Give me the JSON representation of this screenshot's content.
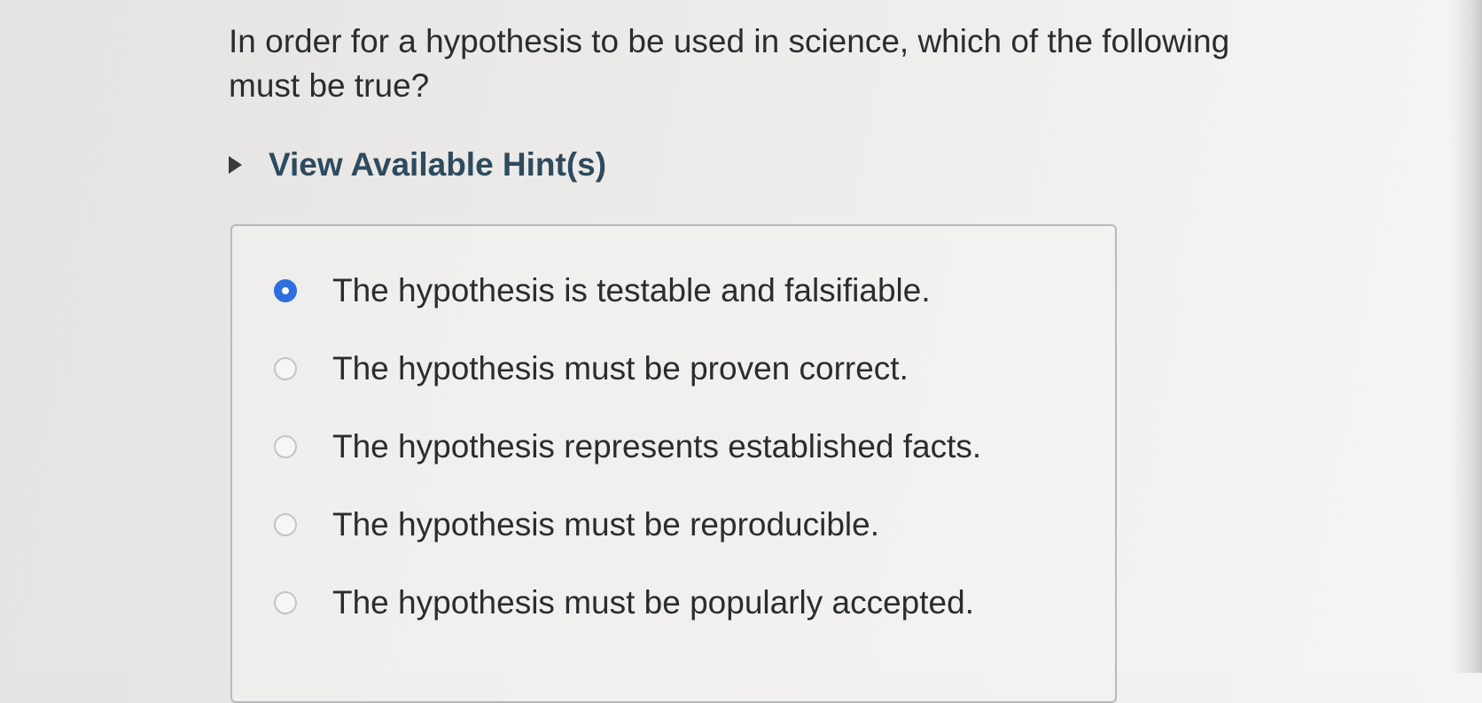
{
  "question": {
    "text": "In order for a hypothesis to be used in science, which of the following must be true?"
  },
  "hint": {
    "label": "View Available Hint(s)",
    "icon": "triangle-right-icon"
  },
  "options": [
    {
      "label": "The hypothesis is testable and falsifiable.",
      "selected": true
    },
    {
      "label": "The hypothesis must be proven correct.",
      "selected": false
    },
    {
      "label": "The hypothesis represents established facts.",
      "selected": false
    },
    {
      "label": "The hypothesis must be reproducible.",
      "selected": false
    },
    {
      "label": "The hypothesis must be popularly accepted.",
      "selected": false
    }
  ],
  "colors": {
    "radio_selected": "#2f6ede",
    "hint_text": "#2e4a5e"
  }
}
